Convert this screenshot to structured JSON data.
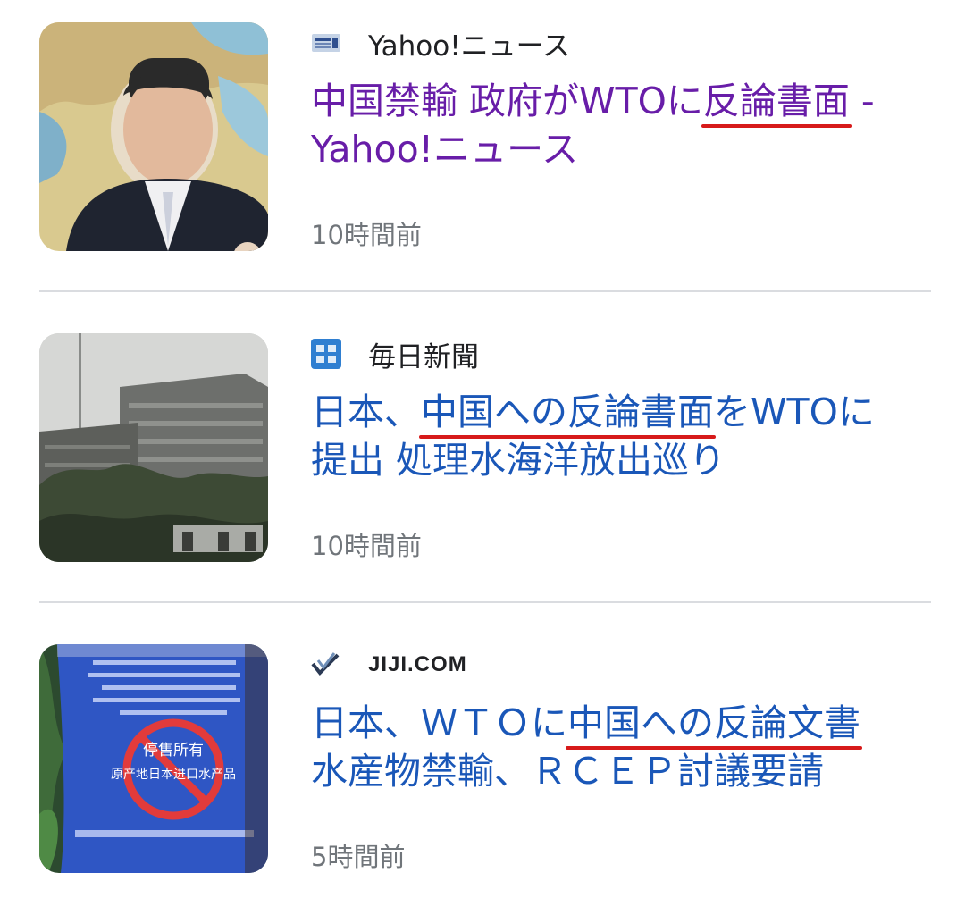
{
  "articles": [
    {
      "source": "Yahoo!ニュース",
      "source_icon": "yahoo-news-icon",
      "headline": {
        "line1_pre": "中国禁輸 政府がWTOに",
        "line1_mark": "反論書面",
        "line1_post": " -",
        "line2": "Yahoo!ニュース"
      },
      "time": "10時間前",
      "headline_color": "#681da8"
    },
    {
      "source": "毎日新聞",
      "source_icon": "mainichi-icon",
      "headline": {
        "line1_pre": "日本、",
        "line1_mark": "中国への反論書面",
        "line1_post": "をWTOに",
        "line2": "提出 処理水海洋放出巡り"
      },
      "time": "10時間前",
      "headline_color": "#1a57b8"
    },
    {
      "source": "JIJI.COM",
      "source_icon": "jiji-icon",
      "headline": {
        "line1_pre": "日本、ＷＴＯに",
        "line1_mark": "中国への反論文書",
        "line1_post": "",
        "line2": "水産物禁輸、ＲＣＥＰ討議要請"
      },
      "time": "5時間前",
      "headline_color": "#1a57b8",
      "thumb_sign_lines": [
        "停售所有",
        "原产地日本进口水产品"
      ]
    }
  ],
  "colors": {
    "underline": "#d71a1a",
    "divider": "#dadce0",
    "time_text": "#70757a"
  }
}
